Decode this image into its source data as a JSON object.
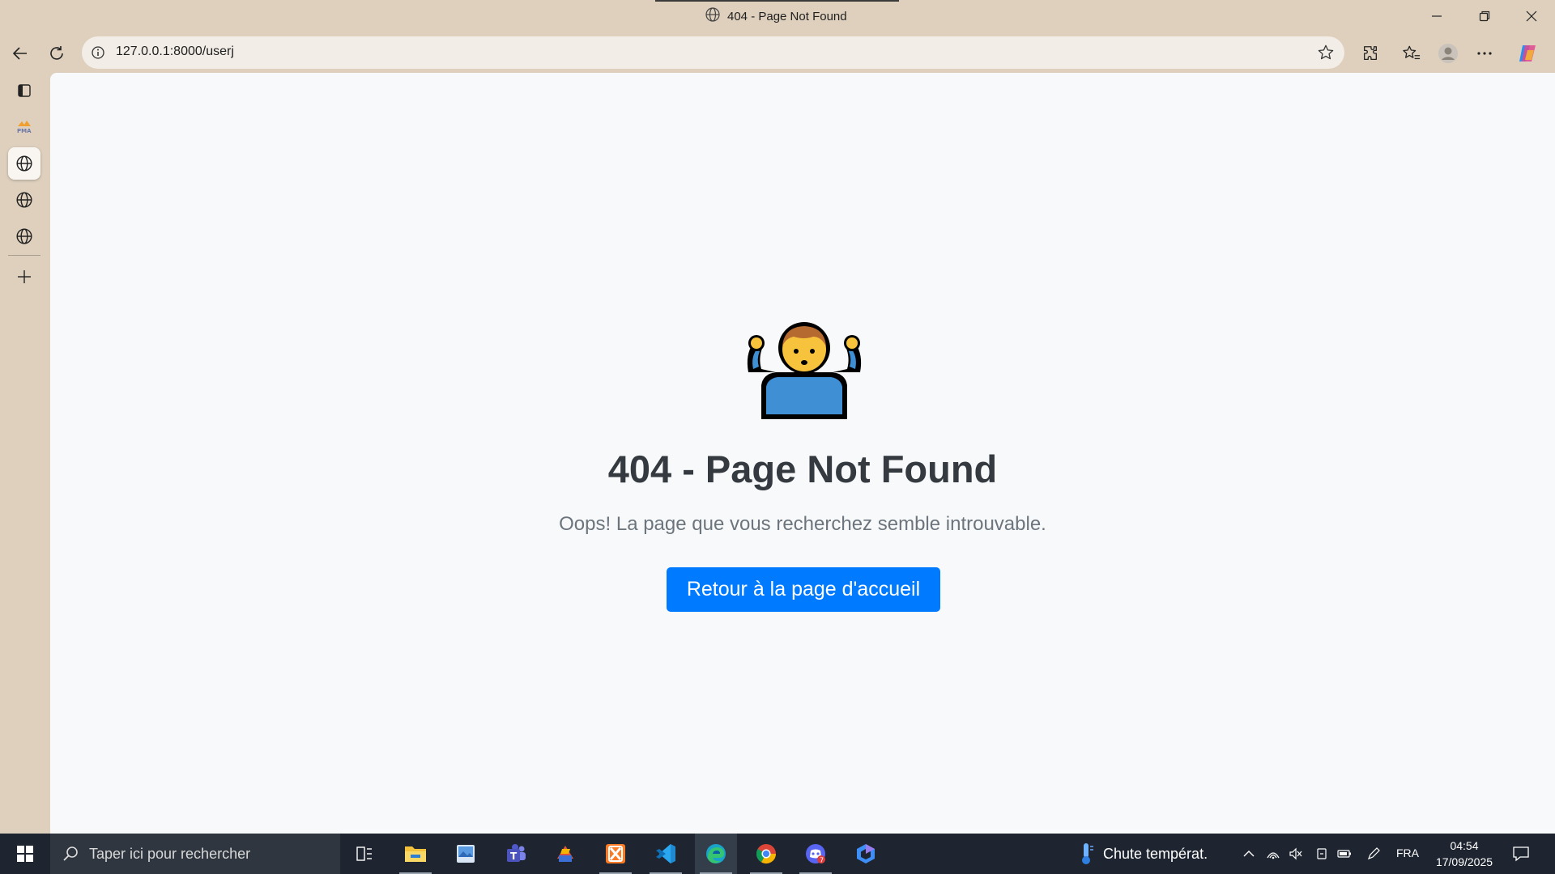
{
  "window": {
    "tab_title": "404 - Page Not Found"
  },
  "toolbar": {
    "url": "127.0.0.1:8000/userj"
  },
  "page": {
    "emoji": "🤷‍♂️",
    "heading": "404 - Page Not Found",
    "message": "Oops! La page que vous recherchez semble introuvable.",
    "home_button_label": "Retour à la page d'accueil"
  },
  "taskbar": {
    "search_placeholder": "Taper ici pour rechercher",
    "weather_text": "Chute températ.",
    "language": "FRA",
    "time": "04:54",
    "date": "17/09/2025"
  },
  "colors": {
    "browser_frame": "#ded0bd",
    "page_background": "#f8f9fa",
    "heading": "#343a40",
    "message": "#6c757d",
    "button": "#007bff",
    "taskbar": "#1e2530"
  }
}
